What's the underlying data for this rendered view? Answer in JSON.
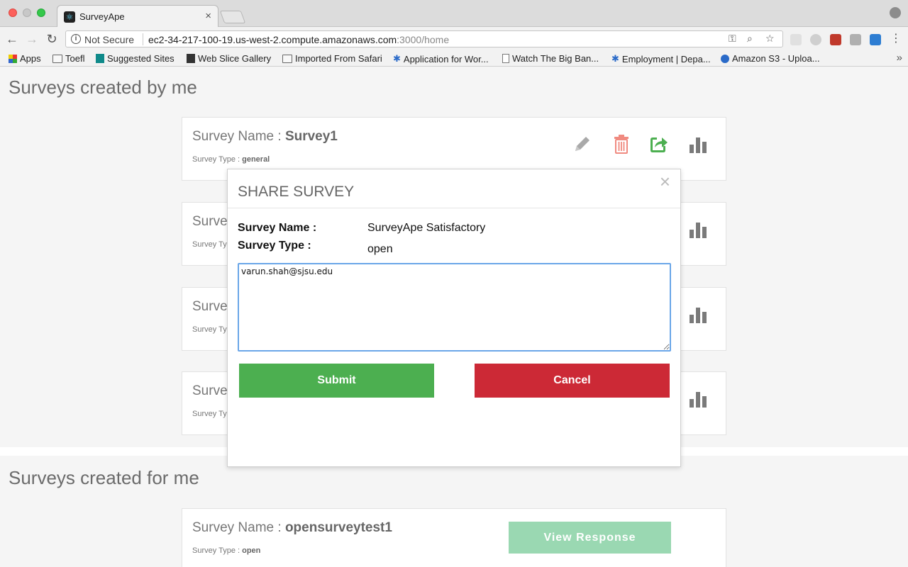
{
  "browser": {
    "tab_title": "SurveyApe",
    "tab_close": "×",
    "security_label": "Not Secure",
    "url_host": "ec2-34-217-100-19.us-west-2.compute.amazonaws.com",
    "url_rest": ":3000/home",
    "bookmarks": [
      {
        "label": "Apps",
        "icon": "apps-grid-icon"
      },
      {
        "label": "Toefl",
        "icon": "folder-icon"
      },
      {
        "label": "Suggested Sites",
        "icon": "bing-icon"
      },
      {
        "label": "Web Slice Gallery",
        "icon": "web-slice-icon"
      },
      {
        "label": "Imported From Safari",
        "icon": "folder-icon"
      },
      {
        "label": "Application for Wor...",
        "icon": "gear-logo-icon"
      },
      {
        "label": "Watch The Big Ban...",
        "icon": "page-icon"
      },
      {
        "label": "Employment | Depa...",
        "icon": "gear-logo-icon"
      },
      {
        "label": "Amazon S3 - Uploa...",
        "icon": "s3-icon"
      }
    ],
    "bookmarks_more": "»"
  },
  "created_by_me": {
    "heading": "Surveys created by me",
    "cards": [
      {
        "name_prefix": "Survey Name : ",
        "name": "Survey1",
        "type_prefix": "Survey Type : ",
        "type": "general"
      },
      {
        "name_prefix": "Surve",
        "name": "",
        "type_prefix": "Survey Ty",
        "type": ""
      },
      {
        "name_prefix": "Surve",
        "name": "",
        "type_prefix": "Survey Ty",
        "type": ""
      },
      {
        "name_prefix": "Surve",
        "name": "",
        "type_prefix": "Survey Ty",
        "type": ""
      }
    ]
  },
  "created_for_me": {
    "heading": "Surveys created for me",
    "cards": [
      {
        "name_prefix": "Survey Name : ",
        "name": "opensurveytest1",
        "type_prefix": "Survey Type : ",
        "type": "open",
        "button": "View Response"
      }
    ]
  },
  "modal": {
    "title": "SHARE SURVEY",
    "close": "×",
    "name_label": "Survey Name :",
    "name_value": "SurveyApe Satisfactory",
    "type_label": "Survey Type :",
    "type_value": "open",
    "textarea_value": "varun.shah@sjsu.edu",
    "submit_label": "Submit",
    "cancel_label": "Cancel"
  },
  "colors": {
    "edit_icon": "#a9a9a9",
    "delete_icon": "#f08a80",
    "share_icon": "#4caf50",
    "stats_icon": "#7a7a7a",
    "submit": "#4caf50",
    "cancel": "#cc2936",
    "view_response": "#9ad8b2"
  }
}
